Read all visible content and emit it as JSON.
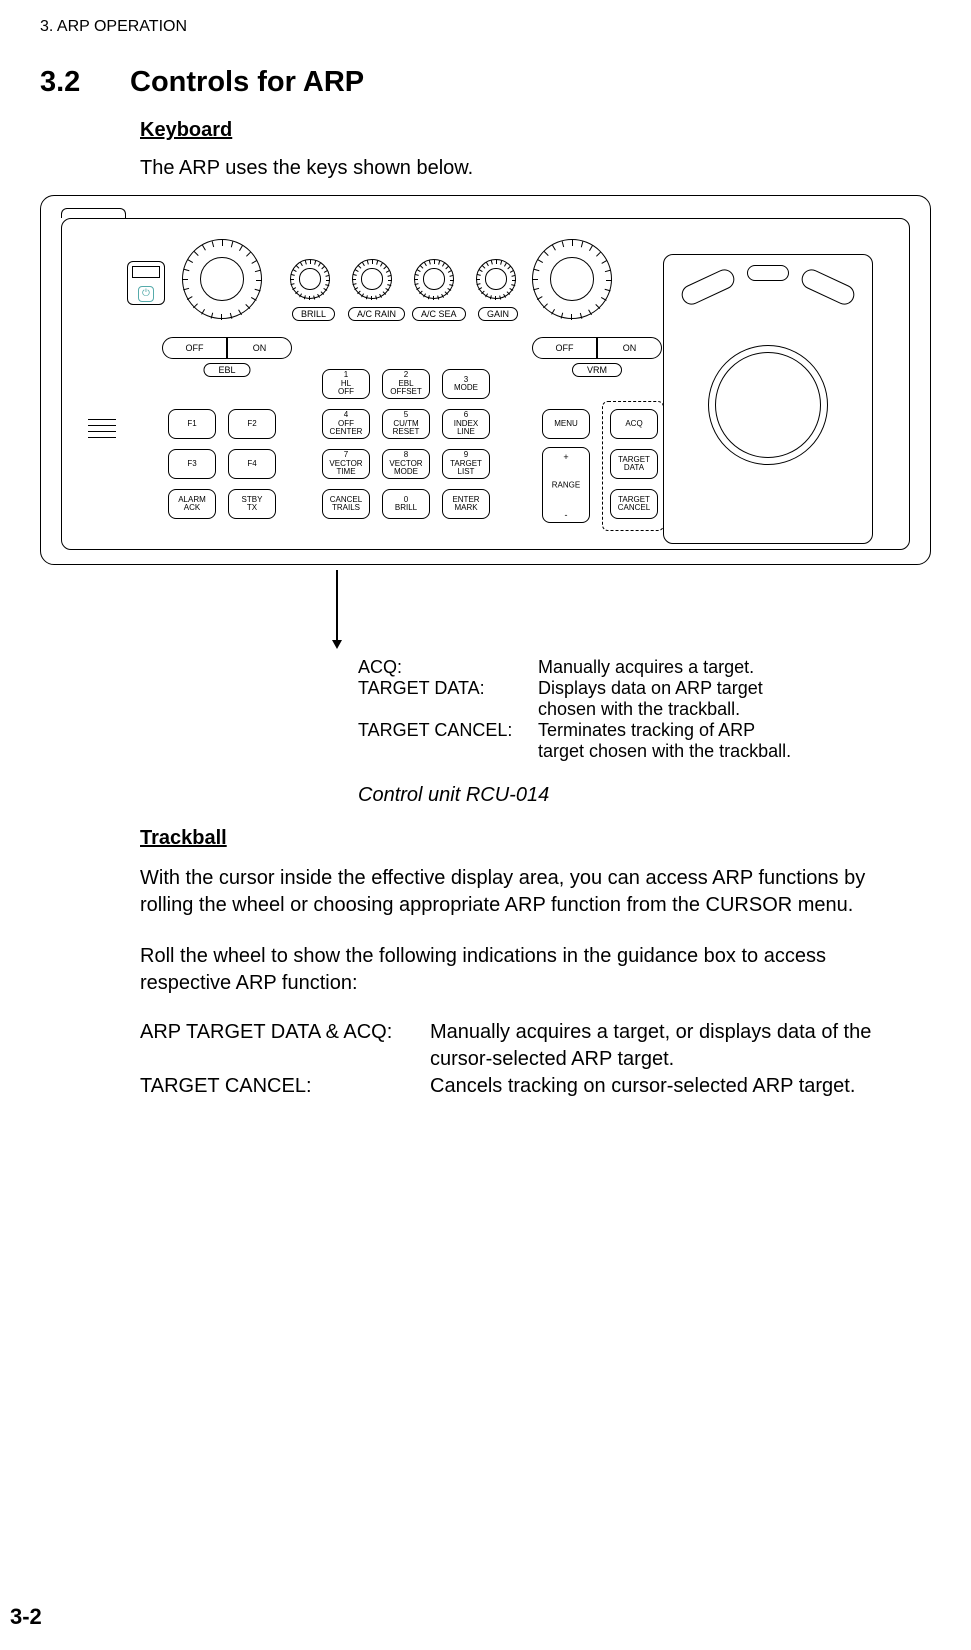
{
  "chapter_header": "3. ARP OPERATION",
  "section_number": "3.2",
  "section_title": "Controls for ARP",
  "sub_keyboard": "Keyboard",
  "lead_kbd": "The ARP uses the keys shown below.",
  "panel": {
    "knob_labels": {
      "brill": "BRILL",
      "ac_rain": "A/C RAIN",
      "ac_sea": "A/C SEA",
      "gain": "GAIN"
    },
    "rocker": {
      "off": "OFF",
      "on": "ON",
      "ebl": "EBL",
      "vrm": "VRM"
    },
    "keys": {
      "f1": "F1",
      "f2": "F2",
      "f3": "F3",
      "f4": "F4",
      "alarm_ack": "ALARM\nACK",
      "stby_tx": "STBY\nTX",
      "k1": "1\nHL\nOFF",
      "k2": "2\nEBL\nOFFSET",
      "k3": "3\nMODE",
      "k4": "4\nOFF\nCENTER",
      "k5": "5\nCU/TM\nRESET",
      "k6": "6\nINDEX\nLINE",
      "k7": "7\nVECTOR\nTIME",
      "k8": "8\nVECTOR\nMODE",
      "k9": "9\nTARGET\nLIST",
      "cancel_trails": "CANCEL\nTRAILS",
      "k0": "0\nBRILL",
      "enter_mark": "ENTER\nMARK",
      "menu": "MENU",
      "acq": "ACQ",
      "target_data": "TARGET\nDATA",
      "target_cancel": "TARGET\nCANCEL",
      "range_plus": "+",
      "range_minus": "-",
      "range_mid": "RANGE"
    }
  },
  "callout": {
    "acq_k": "ACQ:",
    "acq_v": "Manually acquires a target.",
    "td_k": "TARGET DATA:",
    "td_v1": "Displays data on ARP target",
    "td_v2": "chosen with the trackball.",
    "tc_k": "TARGET CANCEL:",
    "tc_v1": "Terminates tracking of ARP",
    "tc_v2": "target chosen with the trackball."
  },
  "fig_caption": "Control unit RCU-014",
  "sub_trackball": "Trackball",
  "p1": "With the cursor inside the effective display area, you can access ARP functions by rolling the wheel or choosing appropriate ARP function from the CURSOR menu.",
  "p2": "Roll the wheel to show the following indications in the guidance box to access respective ARP function:",
  "func": {
    "k1": "ARP TARGET DATA & ACQ:",
    "v1a": "Manually acquires a target, or displays data of the",
    "v1b": "cursor-selected ARP target.",
    "k2": "TARGET CANCEL:",
    "v2": "Cancels tracking on cursor-selected ARP target."
  },
  "page_number": "3-2"
}
